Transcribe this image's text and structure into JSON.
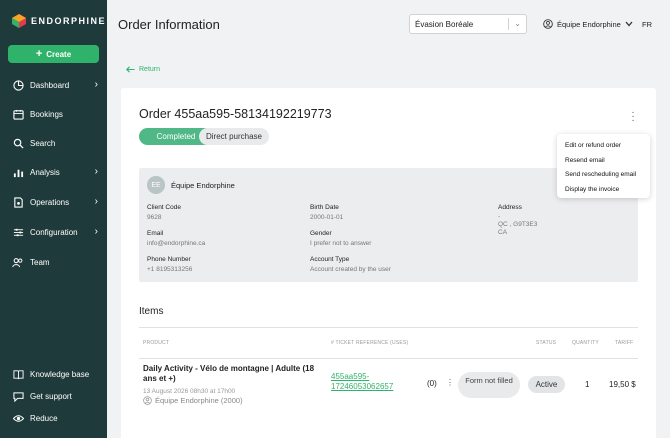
{
  "app": {
    "logo_text": "ENDORPHINE",
    "create_label": "Create"
  },
  "sidebar": {
    "items": [
      {
        "label": "Dashboard",
        "icon": "dashboard-icon"
      },
      {
        "label": "Bookings",
        "icon": "calendar-icon"
      },
      {
        "label": "Search",
        "icon": "search-icon"
      },
      {
        "label": "Analysis",
        "icon": "chart-icon"
      },
      {
        "label": "Operations",
        "icon": "operations-icon"
      },
      {
        "label": "Configuration",
        "icon": "sliders-icon"
      },
      {
        "label": "Team",
        "icon": "team-icon"
      }
    ],
    "bottom": [
      {
        "label": "Knowledge base",
        "icon": "book-icon"
      },
      {
        "label": "Get support",
        "icon": "chat-icon"
      },
      {
        "label": "Reduce",
        "icon": "eye-icon"
      }
    ]
  },
  "header": {
    "title": "Order Information",
    "select_value": "Évasion Boréale",
    "account": "Équipe Endorphine",
    "lang": "FR"
  },
  "return_label": "Return",
  "order": {
    "title": "Order 455aa595-58134192219773",
    "status": "Completed",
    "type": "Direct purchase"
  },
  "menu": [
    "Edit or refund order",
    "Resend email",
    "Send rescheduling email",
    "Display the invoice"
  ],
  "customer": {
    "initials": "EE",
    "name": "Équipe Endorphine",
    "client_code_label": "Client Code",
    "client_code": "9628",
    "email_label": "Email",
    "email": "info@endorphine.ca",
    "phone_label": "Phone Number",
    "phone": "+1 8195313256",
    "birth_label": "Birth Date",
    "birth": "2000-01-01",
    "gender_label": "Gender",
    "gender": "I prefer not to answer",
    "account_type_label": "Account Type",
    "account_type": "Account created by the user",
    "address_label": "Address",
    "address_line1": "-",
    "address_line2": "QC , G9T3E3",
    "address_line3": "CA"
  },
  "items": {
    "title": "Items",
    "columns": {
      "product": "PRODUCT",
      "ticket": "# TICKET REFERENCE (USES)",
      "status": "STATUS",
      "quantity": "QUANTITY",
      "tariff": "TARIFF"
    },
    "rows": [
      {
        "product": "Daily Activity - Vélo de montagne | Adulte (18 ans et +)",
        "date": "13 August 2026 08h30 at 17h00",
        "organizer": "Équipe Endorphine (2000)",
        "ticket_line1": "455aa595-",
        "ticket_line2": "17246053062657",
        "uses": "(0)",
        "form": "Form not filled",
        "status": "Active",
        "quantity": "1",
        "tariff": "19,50 $"
      }
    ]
  },
  "colors": {
    "sidebar": "#1f3a3a",
    "accent": "#2fb36b",
    "completed": "#4fb886"
  }
}
